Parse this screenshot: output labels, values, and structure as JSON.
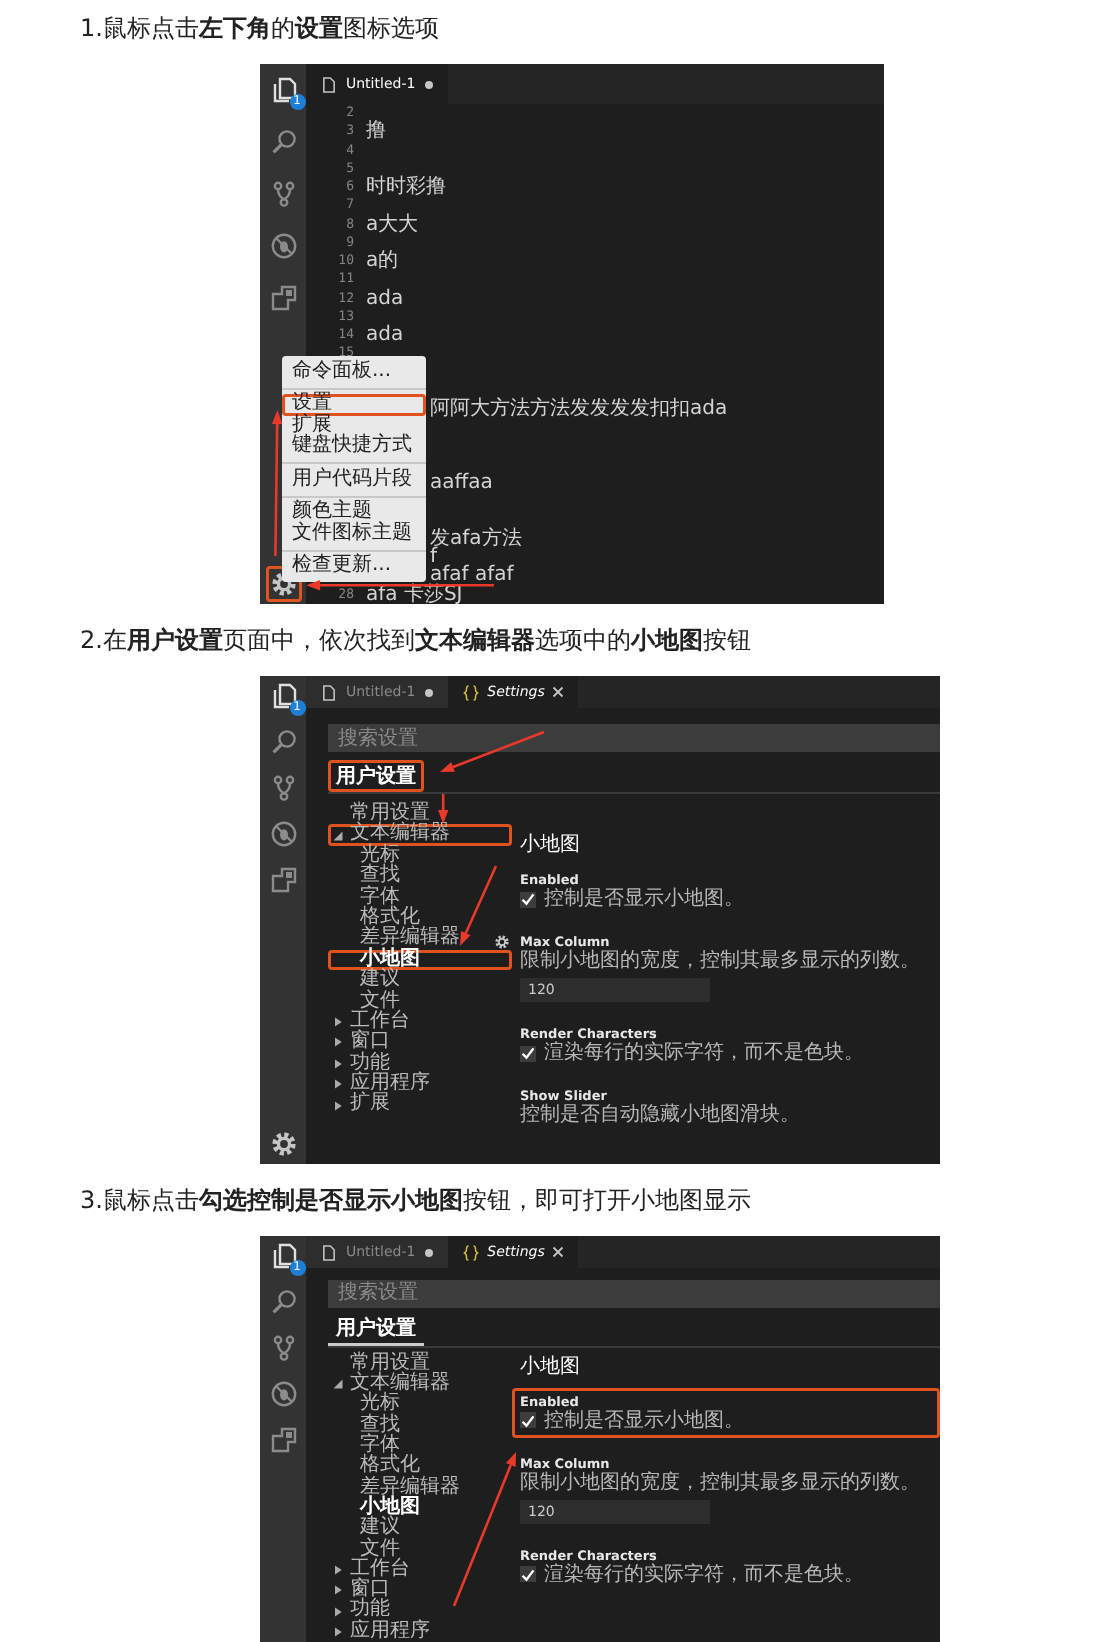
{
  "steps": [
    {
      "instruction": "1.鼠标点击**左下角**的**设置**图标选项",
      "screenshot": {
        "activity_bar": {
          "badge": "1",
          "settings_gear": true,
          "gear_highlighted": true
        },
        "tabs": [
          {
            "kind": "file",
            "label": "Untitled-1",
            "dirty": true,
            "selected": true
          }
        ],
        "editor": {
          "lines": [
            {
              "kind": "plain",
              "number": "2"
            },
            {
              "kind": "plain",
              "number": "3",
              "text": "撸"
            },
            {
              "kind": "plain",
              "number": "4"
            },
            {
              "kind": "plain",
              "number": "5"
            },
            {
              "kind": "plain",
              "number": "6",
              "text": "时时彩撸"
            },
            {
              "kind": "plain",
              "number": "7"
            },
            {
              "kind": "plain",
              "number": "8",
              "text": "a大大"
            },
            {
              "kind": "plain",
              "number": "9"
            },
            {
              "kind": "plain",
              "number": "10",
              "text": "a的"
            },
            {
              "kind": "plain",
              "number": "11"
            },
            {
              "kind": "plain",
              "number": "12",
              "text": "ada"
            },
            {
              "kind": "plain",
              "number": "13"
            },
            {
              "kind": "plain",
              "number": "14",
              "text": "ada"
            },
            {
              "kind": "plain",
              "number": "15"
            },
            {
              "kind": "under_menu"
            },
            {
              "kind": "under_menu"
            },
            {
              "kind": "under_menu",
              "text": "阿阿大方法方法发发发发扣扣ada"
            },
            {
              "kind": "under_menu"
            },
            {
              "kind": "under_menu"
            },
            {
              "kind": "under_menu"
            },
            {
              "kind": "under_menu",
              "text": "aaffaa"
            },
            {
              "kind": "under_menu"
            },
            {
              "kind": "under_menu"
            },
            {
              "kind": "under_menu",
              "text": "发afa方法"
            },
            {
              "kind": "under_menu",
              "text": "f"
            },
            {
              "kind": "under_menu",
              "text": "afaf afaf"
            },
            {
              "kind": "plain",
              "number": "28",
              "text": "afa 卡莎SJ"
            }
          ]
        },
        "context_menu": {
          "groups": [
            [
              {
                "label": "命令面板...",
                "highlighted": false
              }
            ],
            [
              {
                "label": "设置",
                "highlighted": true
              },
              {
                "label": "扩展",
                "highlighted": false
              },
              {
                "label": "键盘快捷方式",
                "highlighted": false
              }
            ],
            [
              {
                "label": "用户代码片段",
                "highlighted": false
              }
            ],
            [
              {
                "label": "颜色主题",
                "highlighted": false
              },
              {
                "label": "文件图标主题",
                "highlighted": false
              }
            ],
            [
              {
                "label": "检查更新...",
                "highlighted": false
              }
            ]
          ]
        }
      }
    },
    {
      "instruction": "2.在**用户设置**页面中，依次找到**文本编辑器**选项中的**小地图**按钮",
      "screenshot": {
        "activity_bar": {
          "badge": "1",
          "settings_gear": true,
          "gear_highlighted": false
        },
        "tabs": [
          {
            "kind": "file",
            "label": "Untitled-1",
            "dirty": true,
            "selected": false
          },
          {
            "kind": "settings",
            "label": "Settings",
            "dirty": false,
            "selected": true
          }
        ],
        "settings": {
          "search_placeholder": "搜索设置",
          "scope_tab": {
            "label": "用户设置",
            "highlighted": true,
            "selected": false
          },
          "tree": [
            {
              "label": "常用设置",
              "selected": false,
              "highlighted": false
            },
            {
              "label": "文本编辑器",
              "selected": false,
              "highlighted": true,
              "expanded": true,
              "children": [
                {
                  "label": "光标",
                  "selected": false,
                  "highlighted": false
                },
                {
                  "label": "查找",
                  "selected": false,
                  "highlighted": false
                },
                {
                  "label": "字体",
                  "selected": false,
                  "highlighted": false
                },
                {
                  "label": "格式化",
                  "selected": false,
                  "highlighted": false
                },
                {
                  "label": "差异编辑器",
                  "selected": false,
                  "highlighted": false
                },
                {
                  "label": "小地图",
                  "selected": true,
                  "highlighted": true
                },
                {
                  "label": "建议",
                  "selected": false,
                  "highlighted": false
                },
                {
                  "label": "文件",
                  "selected": false,
                  "highlighted": false
                }
              ]
            },
            {
              "label": "工作台",
              "selected": false,
              "highlighted": false,
              "expanded": false
            },
            {
              "label": "窗口",
              "selected": false,
              "highlighted": false,
              "expanded": false
            },
            {
              "label": "功能",
              "selected": false,
              "highlighted": false,
              "expanded": false
            },
            {
              "label": "应用程序",
              "selected": false,
              "highlighted": false,
              "expanded": false
            },
            {
              "label": "扩展",
              "selected": false,
              "highlighted": false,
              "expanded": false
            }
          ],
          "section_title": "小地图",
          "entries": [
            {
              "kind": "checkbox",
              "title": "Enabled",
              "description": "控制是否显示小地图。",
              "checked": true,
              "highlighted": false,
              "gear": false
            },
            {
              "kind": "number",
              "title": "Max Column",
              "description": "限制小地图的宽度，控制其最多显示的列数。",
              "value": "120",
              "highlighted": false,
              "gear": true
            },
            {
              "kind": "checkbox",
              "title": "Render Characters",
              "description": "渲染每行的实际字符，而不是色块。",
              "checked": true,
              "highlighted": false,
              "gear": false
            },
            {
              "kind": "text",
              "title": "Show Slider",
              "description": "控制是否自动隐藏小地图滑块。",
              "highlighted": false,
              "gear": false
            }
          ]
        }
      }
    },
    {
      "instruction": "3.鼠标点击**勾选控制是否显示小地图**按钮，即可打开小地图显示",
      "screenshot": {
        "activity_bar": {
          "badge": "1",
          "settings_gear": false
        },
        "tabs": [
          {
            "kind": "file",
            "label": "Untitled-1",
            "dirty": true,
            "selected": false
          },
          {
            "kind": "settings",
            "label": "Settings",
            "dirty": false,
            "selected": true
          }
        ],
        "settings": {
          "search_placeholder": "搜索设置",
          "scope_tab": {
            "label": "用户设置",
            "highlighted": false,
            "selected": true
          },
          "tree": [
            {
              "label": "常用设置",
              "selected": false,
              "highlighted": false
            },
            {
              "label": "文本编辑器",
              "selected": false,
              "highlighted": false,
              "expanded": true,
              "children": [
                {
                  "label": "光标",
                  "selected": false,
                  "highlighted": false
                },
                {
                  "label": "查找",
                  "selected": false,
                  "highlighted": false
                },
                {
                  "label": "字体",
                  "selected": false,
                  "highlighted": false
                },
                {
                  "label": "格式化",
                  "selected": false,
                  "highlighted": false
                },
                {
                  "label": "差异编辑器",
                  "selected": false,
                  "highlighted": false
                },
                {
                  "label": "小地图",
                  "selected": true,
                  "highlighted": false
                },
                {
                  "label": "建议",
                  "selected": false,
                  "highlighted": false
                },
                {
                  "label": "文件",
                  "selected": false,
                  "highlighted": false
                }
              ]
            },
            {
              "label": "工作台",
              "selected": false,
              "highlighted": false,
              "expanded": false
            },
            {
              "label": "窗口",
              "selected": false,
              "highlighted": false,
              "expanded": false
            },
            {
              "label": "功能",
              "selected": false,
              "highlighted": false,
              "expanded": false
            },
            {
              "label": "应用程序",
              "selected": false,
              "highlighted": false,
              "expanded": false
            }
          ],
          "section_title": "小地图",
          "entries": [
            {
              "kind": "checkbox",
              "title": "Enabled",
              "description": "控制是否显示小地图。",
              "checked": true,
              "highlighted": true,
              "gear": false
            },
            {
              "kind": "number",
              "title": "Max Column",
              "description": "限制小地图的宽度，控制其最多显示的列数。",
              "value": "120",
              "highlighted": false,
              "gear": false
            },
            {
              "kind": "checkbox",
              "title": "Render Characters",
              "description": "渲染每行的实际字符，而不是色块。",
              "checked": true,
              "highlighted": false,
              "gear": false
            }
          ]
        }
      }
    }
  ]
}
